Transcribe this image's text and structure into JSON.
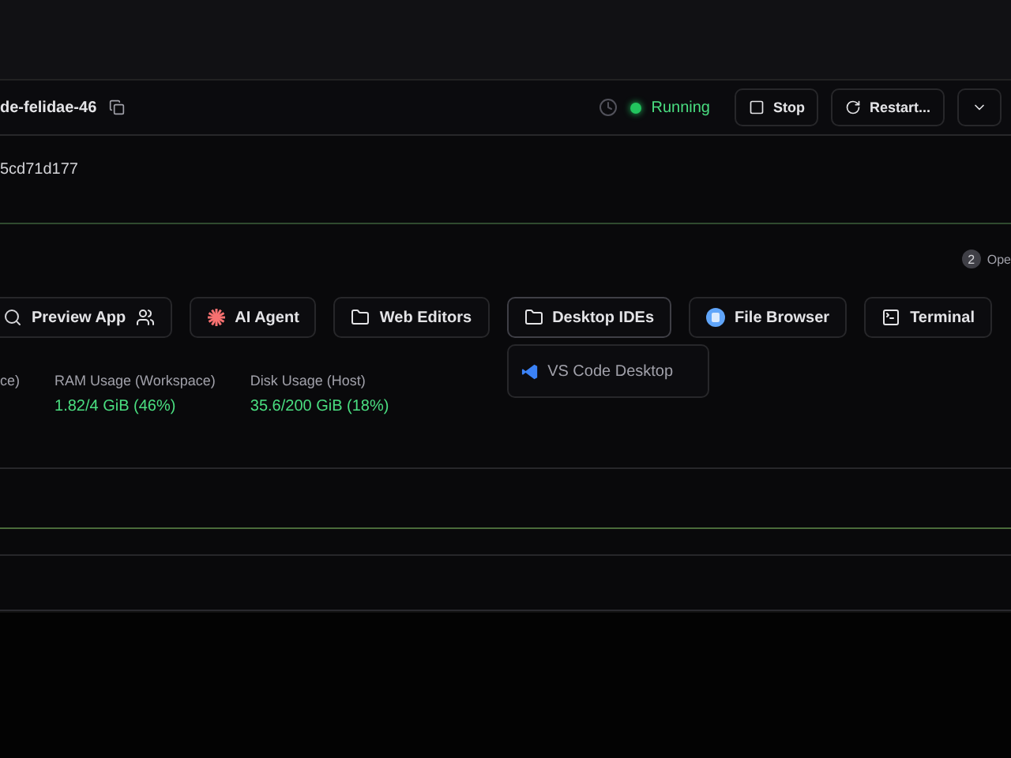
{
  "header": {
    "workspace_name": "de-felidae-46",
    "status": {
      "label": "Running",
      "running": true
    },
    "buttons": [
      {
        "kind": "stop",
        "label": "Stop"
      },
      {
        "kind": "restart",
        "label": "Restart..."
      },
      {
        "kind": "menu"
      }
    ]
  },
  "id_text": "5cd71d177",
  "open_badge": {
    "count": "2",
    "label": "Ope"
  },
  "apps": [
    {
      "kind": "preview",
      "label": "Preview App",
      "expanded": false
    },
    {
      "kind": "agent",
      "label": "AI Agent",
      "expanded": false
    },
    {
      "kind": "folder",
      "label": "Web Editors",
      "expanded": false
    },
    {
      "kind": "folder",
      "label": "Desktop IDEs",
      "expanded": true,
      "menu": [
        "VS Code Desktop"
      ]
    },
    {
      "kind": "files",
      "label": "File Browser",
      "expanded": false
    },
    {
      "kind": "terminal",
      "label": "Terminal",
      "expanded": false
    }
  ],
  "stats": [
    {
      "label": "ce)"
    },
    {
      "label": "RAM Usage (Workspace)",
      "value": "1.82/4 GiB (46%)"
    },
    {
      "label": "Disk Usage (Host)",
      "value": "35.6/200 GiB (18%)"
    }
  ]
}
